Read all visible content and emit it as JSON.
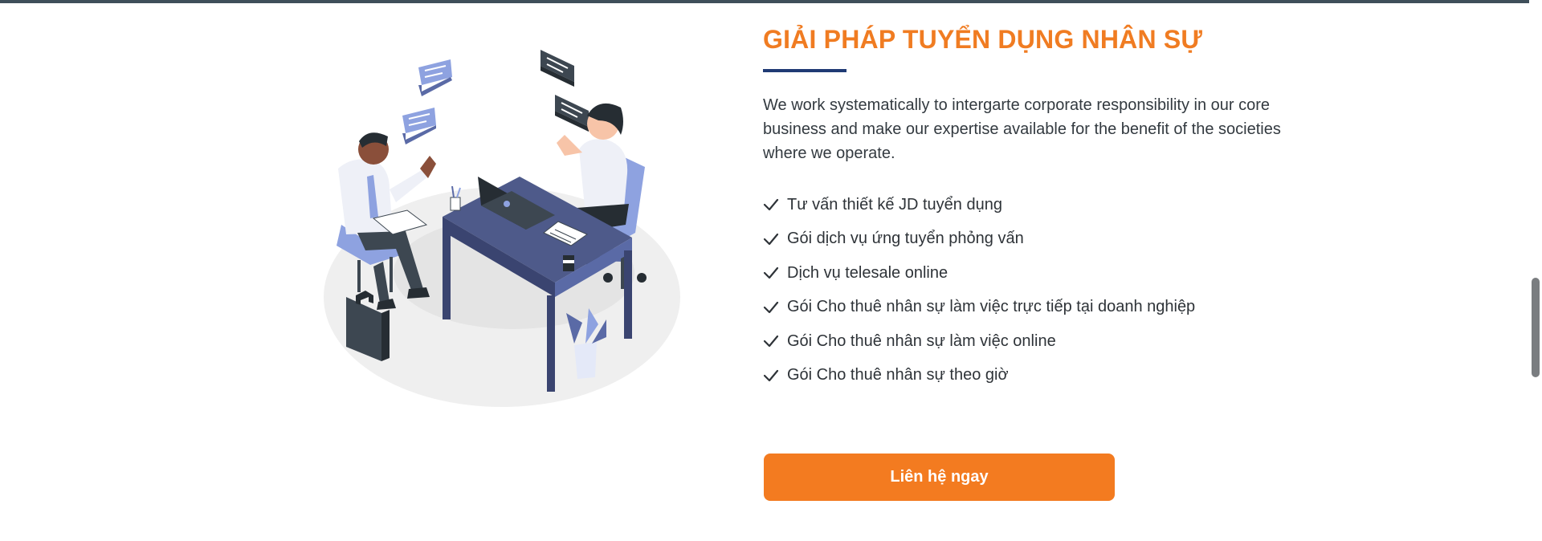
{
  "section": {
    "title": "GIẢI PHÁP TUYỂN DỤNG NHÂN SỰ",
    "intro": "We work systematically to intergarte corporate responsibility in our core business and make our expertise available for the benefit of the societies where we operate.",
    "features": [
      {
        "label": "Tư vấn thiết kế JD tuyển dụng",
        "icon": "check-icon"
      },
      {
        "label": "Gói dịch vụ ứng tuyển phỏng vấn",
        "icon": "check-icon"
      },
      {
        "label": "Dịch vụ telesale online",
        "icon": "check-icon"
      },
      {
        "label": "Gói Cho thuê nhân sự làm việc trực tiếp tại doanh nghiệp",
        "icon": "check-icon"
      },
      {
        "label": "Gói Cho thuê nhân sự làm việc online",
        "icon": "check-icon"
      },
      {
        "label": "Gói Cho thuê nhân sự theo giờ",
        "icon": "check-icon"
      }
    ],
    "cta_label": "Liên hệ ngay"
  },
  "colors": {
    "accent": "#f37b20",
    "title": "#f07c22",
    "underline": "#1f3a74",
    "illustration_primary": "#5a6aa6",
    "illustration_light": "#8ea2e0"
  },
  "illustration": {
    "icon": "office-meeting-illustration"
  }
}
